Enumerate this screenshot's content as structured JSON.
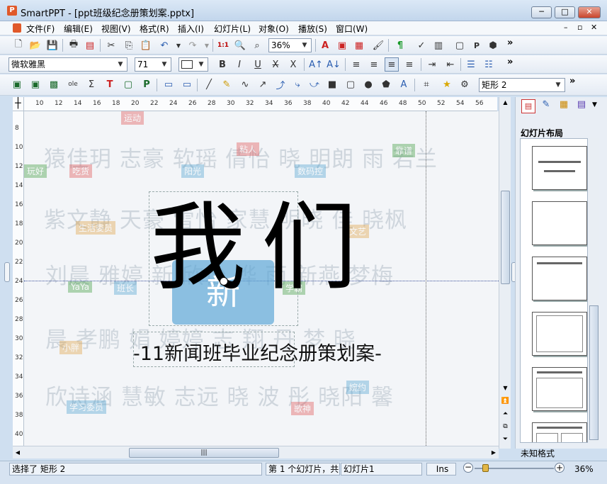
{
  "window": {
    "title": "SmartPPT - [ppt班级纪念册策划案.pptx]",
    "app_icon": "P"
  },
  "menu": [
    "文件(F)",
    "编辑(E)",
    "视图(V)",
    "格式(R)",
    "插入(I)",
    "幻灯片(L)",
    "对象(O)",
    "播放(S)",
    "窗口(W)"
  ],
  "toolbar1": {
    "zoom": "36%",
    "overflow": "»"
  },
  "toolbar2": {
    "font": "微软雅黑",
    "size": "71",
    "overflow": "»"
  },
  "toolbar3": {
    "shape": "矩形 2",
    "overflow": "»"
  },
  "ruler": {
    "h": [
      "10",
      "12",
      "14",
      "16",
      "18",
      "20",
      "22",
      "24",
      "26",
      "28",
      "30",
      "32",
      "34",
      "36",
      "38",
      "40",
      "42",
      "44",
      "46",
      "48",
      "50",
      "52",
      "54",
      "56"
    ],
    "v": [
      "8",
      "10",
      "12",
      "14",
      "16",
      "18",
      "20",
      "22",
      "24",
      "26",
      "28",
      "30",
      "32",
      "34",
      "36",
      "38",
      "40"
    ]
  },
  "slide": {
    "title": "我们",
    "badge": "新",
    "subtitle": "-11新闻班毕业纪念册策划案-",
    "bg_rows": [
      "猿佳玥 志豪 软瑶 倩怡 晓 明朗 雨 若兰",
      "紫文静 天豪 雪怡 家慧 明晓 佳 晓枫",
      "刘晨 雅婷 新 欣怡 桦 雨 新燕 梦梅",
      "晨 孝鹏 娟 婷婷 志 翔 丹 梦 晓",
      "欣诗涵 慧敏 志远 晓 波 彤 晓阳 馨"
    ],
    "bg_tags": [
      "玩好",
      "运动",
      "粘人",
      "学霸",
      "婉约",
      "靠谱",
      "数码控",
      "阳光",
      "生活委员",
      "吃货",
      "YaYa",
      "班长",
      "文艺",
      "学习委员",
      "小胖",
      "歌神"
    ]
  },
  "sidebar": {
    "title": "幻灯片布局",
    "footer": "未知格式"
  },
  "status": {
    "selection": "选择了 矩形 2",
    "slide_pos": "第 1 个幻灯片，共",
    "slide_name": "幻灯片1",
    "mode": "Ins",
    "zoom": "36%"
  },
  "colors": {
    "accent": "#5aa5d6",
    "ppt_red": "#e0592a"
  }
}
